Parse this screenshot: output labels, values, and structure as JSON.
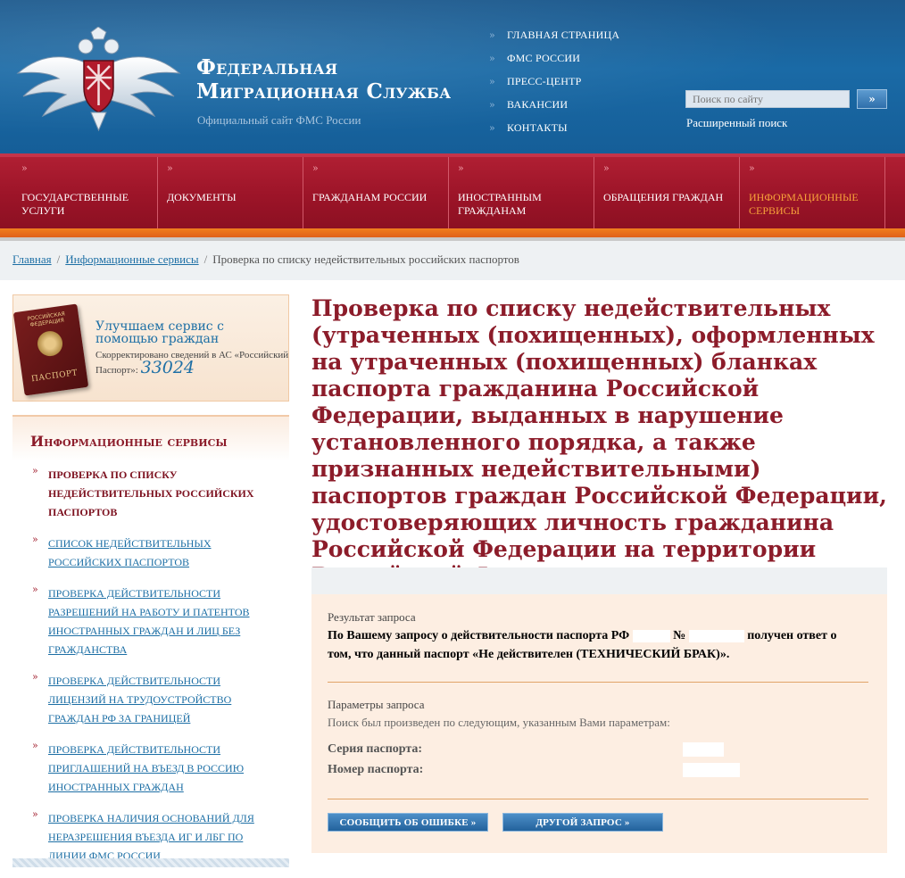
{
  "header": {
    "title_line1": "Федеральная",
    "title_line2": "Миграционная Служба",
    "subtitle": "Официальный сайт ФМС России",
    "emblem_icon": "double-headed-eagle-emblem",
    "top_nav": [
      {
        "label": "ГЛАВНАЯ СТРАНИЦА"
      },
      {
        "label": "ФМС РОССИИ"
      },
      {
        "label": "ПРЕСС-ЦЕНТР"
      },
      {
        "label": "ВАКАНСИИ"
      },
      {
        "label": "КОНТАКТЫ"
      }
    ],
    "nav_arrow": "»",
    "search": {
      "placeholder": "Поиск по сайту",
      "button": "»",
      "advanced": "Расширенный поиск"
    }
  },
  "main_nav": [
    {
      "label": "ГОСУДАРСТВЕННЫЕ УСЛУГИ"
    },
    {
      "label": "ДОКУМЕНТЫ"
    },
    {
      "label": "ГРАЖДАНАМ РОССИИ"
    },
    {
      "label": "ИНОСТРАННЫМ ГРАЖДАНАМ"
    },
    {
      "label": "ОБРАЩЕНИЯ ГРАЖДАН"
    },
    {
      "label": "ИНФОРМАЦИОННЫЕ СЕРВИСЫ",
      "active": true
    }
  ],
  "breadcrumb": {
    "home": "Главная",
    "section": "Информационные сервисы",
    "current": "Проверка по списку недействительных российских паспортов",
    "separator": "/"
  },
  "promo": {
    "passport_top": "РОССИЙСКАЯ ФЕДЕРАЦИЯ",
    "passport_bottom": "ПАСПОРТ",
    "title": "Улучшаем сервис с помощью граждан",
    "text": "Скорректировано сведений в АС «Российский Паспорт»:",
    "count": "33024"
  },
  "sidebar": {
    "title": "Информационные сервисы",
    "items": [
      {
        "label": "Проверка по списку недействительных российских паспортов",
        "active": true
      },
      {
        "label": "Список недействительных российских паспортов"
      },
      {
        "label": "Проверка действительности разрешений на работу и патентов иностранных граждан и лиц без гражданства"
      },
      {
        "label": "Проверка действительности лицензий на трудоустройство граждан РФ за границей"
      },
      {
        "label": "Проверка действительности приглашений на въезд в Россию иностранных граждан"
      },
      {
        "label": "Проверка наличия оснований для неразрешения въезда ИГ и ЛБГ по линии ФМС России"
      }
    ]
  },
  "content": {
    "title": "Проверка по списку недействительных (утраченных (похищенных), оформленных на утраченных (похищенных) бланках паспорта гражданина Российской Федерации, выданных в нарушение установленного порядка, а также признанных недействительными) паспортов граждан Российской Федерации, удостоверяющих личность гражданина Российской Федерации на территории Российской Федерации",
    "result_label": "Результат запроса",
    "result_part1": "По Вашему запросу о действительности паспорта РФ",
    "result_no": "№",
    "result_part2": "получен ответ о том, что данный паспорт «Не действителен (ТЕХНИЧЕСКИЙ БРАК)».",
    "params_label": "Параметры запроса",
    "params_desc": "Поиск был произведен по следующим, указанным Вами параметрам:",
    "series_label": "Серия паспорта:",
    "number_label": "Номер паспорта:",
    "btn_report": "СООБЩИТЬ ОБ ОШИБКЕ »",
    "btn_other": "ДРУГОЙ ЗАПРОС »"
  },
  "colors": {
    "header_blue": "#1a6aa6",
    "nav_red": "#9c1428",
    "accent_orange": "#f07e1e",
    "title_maroon": "#8c1c2a",
    "link_blue": "#1d6fa5",
    "result_bg": "#fdeee2"
  }
}
